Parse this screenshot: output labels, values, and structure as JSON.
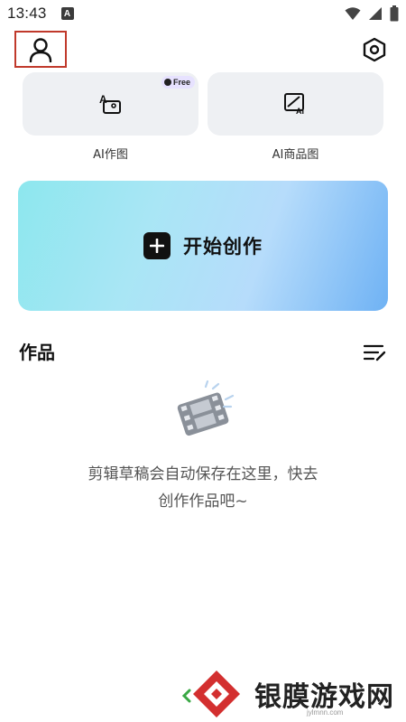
{
  "status_bar": {
    "time": "13:43",
    "notification_badge": "A"
  },
  "icons": {
    "profile": "user-icon",
    "settings": "gear-icon",
    "ai_image": "ai-image-icon",
    "ai_product": "ai-product-icon",
    "create": "plus-icon",
    "edit_list": "edit-list-icon",
    "empty": "film-strip-icon"
  },
  "tools": [
    {
      "label": "AI作图",
      "badge": "Free"
    },
    {
      "label": "AI商品图"
    }
  ],
  "create": {
    "label": "开始创作"
  },
  "works": {
    "title": "作品",
    "empty_text_line1": "剪辑草稿会自动保存在这里，快去",
    "empty_text_line2": "创作作品吧~"
  },
  "watermark": {
    "text": "银膜游戏网",
    "url": "jylmnn.com"
  },
  "colors": {
    "profile_highlight": "#c0392b",
    "banner_gradient_start": "#8de7ee",
    "banner_gradient_end": "#6fb2f4",
    "tool_bg": "#eef0f3",
    "free_badge_bg": "#e7e2ff",
    "watermark_red": "#d32f2f"
  }
}
